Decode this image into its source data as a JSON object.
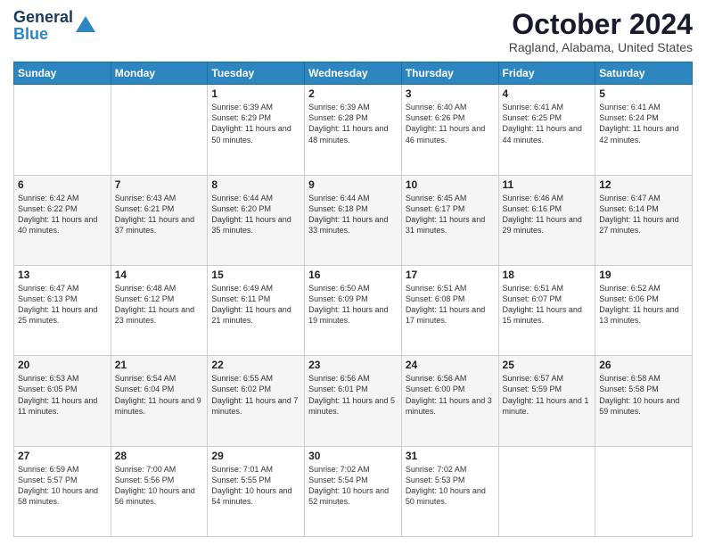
{
  "logo": {
    "line1": "General",
    "line2": "Blue",
    "arrow_color": "#2e86c1"
  },
  "title": "October 2024",
  "location": "Ragland, Alabama, United States",
  "days_of_week": [
    "Sunday",
    "Monday",
    "Tuesday",
    "Wednesday",
    "Thursday",
    "Friday",
    "Saturday"
  ],
  "weeks": [
    [
      {
        "day": "",
        "text": ""
      },
      {
        "day": "",
        "text": ""
      },
      {
        "day": "1",
        "text": "Sunrise: 6:39 AM\nSunset: 6:29 PM\nDaylight: 11 hours and 50 minutes."
      },
      {
        "day": "2",
        "text": "Sunrise: 6:39 AM\nSunset: 6:28 PM\nDaylight: 11 hours and 48 minutes."
      },
      {
        "day": "3",
        "text": "Sunrise: 6:40 AM\nSunset: 6:26 PM\nDaylight: 11 hours and 46 minutes."
      },
      {
        "day": "4",
        "text": "Sunrise: 6:41 AM\nSunset: 6:25 PM\nDaylight: 11 hours and 44 minutes."
      },
      {
        "day": "5",
        "text": "Sunrise: 6:41 AM\nSunset: 6:24 PM\nDaylight: 11 hours and 42 minutes."
      }
    ],
    [
      {
        "day": "6",
        "text": "Sunrise: 6:42 AM\nSunset: 6:22 PM\nDaylight: 11 hours and 40 minutes."
      },
      {
        "day": "7",
        "text": "Sunrise: 6:43 AM\nSunset: 6:21 PM\nDaylight: 11 hours and 37 minutes."
      },
      {
        "day": "8",
        "text": "Sunrise: 6:44 AM\nSunset: 6:20 PM\nDaylight: 11 hours and 35 minutes."
      },
      {
        "day": "9",
        "text": "Sunrise: 6:44 AM\nSunset: 6:18 PM\nDaylight: 11 hours and 33 minutes."
      },
      {
        "day": "10",
        "text": "Sunrise: 6:45 AM\nSunset: 6:17 PM\nDaylight: 11 hours and 31 minutes."
      },
      {
        "day": "11",
        "text": "Sunrise: 6:46 AM\nSunset: 6:16 PM\nDaylight: 11 hours and 29 minutes."
      },
      {
        "day": "12",
        "text": "Sunrise: 6:47 AM\nSunset: 6:14 PM\nDaylight: 11 hours and 27 minutes."
      }
    ],
    [
      {
        "day": "13",
        "text": "Sunrise: 6:47 AM\nSunset: 6:13 PM\nDaylight: 11 hours and 25 minutes."
      },
      {
        "day": "14",
        "text": "Sunrise: 6:48 AM\nSunset: 6:12 PM\nDaylight: 11 hours and 23 minutes."
      },
      {
        "day": "15",
        "text": "Sunrise: 6:49 AM\nSunset: 6:11 PM\nDaylight: 11 hours and 21 minutes."
      },
      {
        "day": "16",
        "text": "Sunrise: 6:50 AM\nSunset: 6:09 PM\nDaylight: 11 hours and 19 minutes."
      },
      {
        "day": "17",
        "text": "Sunrise: 6:51 AM\nSunset: 6:08 PM\nDaylight: 11 hours and 17 minutes."
      },
      {
        "day": "18",
        "text": "Sunrise: 6:51 AM\nSunset: 6:07 PM\nDaylight: 11 hours and 15 minutes."
      },
      {
        "day": "19",
        "text": "Sunrise: 6:52 AM\nSunset: 6:06 PM\nDaylight: 11 hours and 13 minutes."
      }
    ],
    [
      {
        "day": "20",
        "text": "Sunrise: 6:53 AM\nSunset: 6:05 PM\nDaylight: 11 hours and 11 minutes."
      },
      {
        "day": "21",
        "text": "Sunrise: 6:54 AM\nSunset: 6:04 PM\nDaylight: 11 hours and 9 minutes."
      },
      {
        "day": "22",
        "text": "Sunrise: 6:55 AM\nSunset: 6:02 PM\nDaylight: 11 hours and 7 minutes."
      },
      {
        "day": "23",
        "text": "Sunrise: 6:56 AM\nSunset: 6:01 PM\nDaylight: 11 hours and 5 minutes."
      },
      {
        "day": "24",
        "text": "Sunrise: 6:56 AM\nSunset: 6:00 PM\nDaylight: 11 hours and 3 minutes."
      },
      {
        "day": "25",
        "text": "Sunrise: 6:57 AM\nSunset: 5:59 PM\nDaylight: 11 hours and 1 minute."
      },
      {
        "day": "26",
        "text": "Sunrise: 6:58 AM\nSunset: 5:58 PM\nDaylight: 10 hours and 59 minutes."
      }
    ],
    [
      {
        "day": "27",
        "text": "Sunrise: 6:59 AM\nSunset: 5:57 PM\nDaylight: 10 hours and 58 minutes."
      },
      {
        "day": "28",
        "text": "Sunrise: 7:00 AM\nSunset: 5:56 PM\nDaylight: 10 hours and 56 minutes."
      },
      {
        "day": "29",
        "text": "Sunrise: 7:01 AM\nSunset: 5:55 PM\nDaylight: 10 hours and 54 minutes."
      },
      {
        "day": "30",
        "text": "Sunrise: 7:02 AM\nSunset: 5:54 PM\nDaylight: 10 hours and 52 minutes."
      },
      {
        "day": "31",
        "text": "Sunrise: 7:02 AM\nSunset: 5:53 PM\nDaylight: 10 hours and 50 minutes."
      },
      {
        "day": "",
        "text": ""
      },
      {
        "day": "",
        "text": ""
      }
    ]
  ]
}
